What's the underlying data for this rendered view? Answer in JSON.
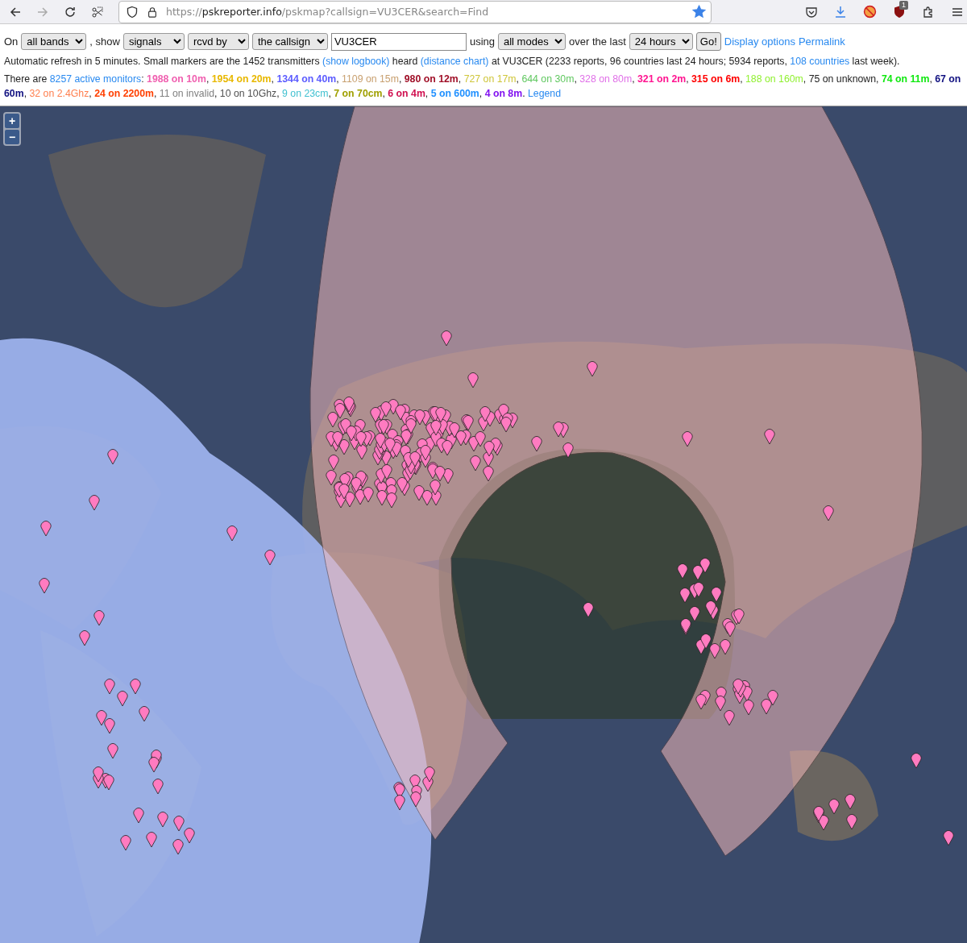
{
  "browser": {
    "back_enabled": true,
    "forward_enabled": false,
    "url": {
      "scheme": "https://",
      "host": "pskreporter.info",
      "path": "/pskmap?callsign=VU3CER&search=Find"
    },
    "bookmarked": true,
    "extension_badge": "1"
  },
  "controls": [
    {
      "kind": "text",
      "text": "On"
    },
    {
      "kind": "select",
      "value": "all bands"
    },
    {
      "kind": "text",
      "text": ", show"
    },
    {
      "kind": "select",
      "value": "signals"
    },
    {
      "kind": "select",
      "value": "rcvd by"
    },
    {
      "kind": "select",
      "value": "the callsign"
    },
    {
      "kind": "input",
      "value": "VU3CER"
    },
    {
      "kind": "text",
      "text": "using"
    },
    {
      "kind": "select",
      "value": "all modes"
    },
    {
      "kind": "text",
      "text": "over the last"
    },
    {
      "kind": "select",
      "value": "24 hours"
    },
    {
      "kind": "button",
      "text": "Go!"
    },
    {
      "kind": "link",
      "text": "Display options"
    },
    {
      "kind": "link",
      "text": "Permalink"
    }
  ],
  "refresh_line": [
    {
      "kind": "text",
      "text": "Automatic refresh in 5 minutes. Small markers are the 1452 transmitters "
    },
    {
      "kind": "link",
      "text": "(show logbook)"
    },
    {
      "kind": "text",
      "text": " heard "
    },
    {
      "kind": "link",
      "text": "(distance chart)"
    },
    {
      "kind": "text",
      "text": " at VU3CER (2233 reports, 96 countries last 24 hours; 5934 reports, "
    },
    {
      "kind": "link",
      "text": "108 countries"
    },
    {
      "kind": "text",
      "text": " last week)."
    }
  ],
  "monitors_line": [
    {
      "kind": "text",
      "text": "There are "
    },
    {
      "kind": "link",
      "text": "8257 active monitors"
    },
    {
      "kind": "text",
      "text": ": "
    },
    {
      "kind": "band",
      "text": "1988 on 10m",
      "color": "#f060b0",
      "bold": true
    },
    {
      "kind": "text",
      "text": ", "
    },
    {
      "kind": "band",
      "text": "1954 on 20m",
      "color": "#e8b800",
      "bold": true
    },
    {
      "kind": "text",
      "text": ", "
    },
    {
      "kind": "band",
      "text": "1344 on 40m",
      "color": "#5c5cff",
      "bold": true
    },
    {
      "kind": "text",
      "text": ", "
    },
    {
      "kind": "band",
      "text": "1109 on 15m",
      "color": "#c8a070",
      "bold": false
    },
    {
      "kind": "text",
      "text": ", "
    },
    {
      "kind": "band",
      "text": "980 on 12m",
      "color": "#a01028",
      "bold": true
    },
    {
      "kind": "text",
      "text": ", "
    },
    {
      "kind": "band",
      "text": "727 on 17m",
      "color": "#cfc63a",
      "bold": false
    },
    {
      "kind": "text",
      "text": ", "
    },
    {
      "kind": "band",
      "text": "644 on 30m",
      "color": "#60c860",
      "bold": false
    },
    {
      "kind": "text",
      "text": ", "
    },
    {
      "kind": "band",
      "text": "328 on 80m",
      "color": "#e070e8",
      "bold": false
    },
    {
      "kind": "text",
      "text": ", "
    },
    {
      "kind": "band",
      "text": "321 on 2m",
      "color": "#ff1490",
      "bold": true
    },
    {
      "kind": "text",
      "text": ", "
    },
    {
      "kind": "band",
      "text": "315 on 6m",
      "color": "#ff0000",
      "bold": true
    },
    {
      "kind": "text",
      "text": ", "
    },
    {
      "kind": "band",
      "text": "188 on 160m",
      "color": "#90f030",
      "bold": false
    },
    {
      "kind": "text",
      "text": ", 75 on unknown, "
    },
    {
      "kind": "band",
      "text": "74 on 11m",
      "color": "#10e810",
      "bold": true
    },
    {
      "kind": "text",
      "text": ", "
    },
    {
      "kind": "band",
      "text": "67 on 60m",
      "color": "#101080",
      "bold": true
    },
    {
      "kind": "text",
      "text": ", "
    },
    {
      "kind": "band",
      "text": "32 on 2.4Ghz",
      "color": "#ff8050",
      "bold": false
    },
    {
      "kind": "text",
      "text": ", "
    },
    {
      "kind": "band",
      "text": "24 on 2200m",
      "color": "#ff4000",
      "bold": true
    },
    {
      "kind": "text",
      "text": ", "
    },
    {
      "kind": "band",
      "text": "11 on invalid",
      "color": "#808080",
      "bold": false
    },
    {
      "kind": "text",
      "text": ", "
    },
    {
      "kind": "band",
      "text": "10 on 10Ghz",
      "color": "#505050",
      "bold": false
    },
    {
      "kind": "text",
      "text": ", "
    },
    {
      "kind": "band",
      "text": "9 on 23cm",
      "color": "#40c0d0",
      "bold": false
    },
    {
      "kind": "text",
      "text": ", "
    },
    {
      "kind": "band",
      "text": "7 on 70cm",
      "color": "#a0a000",
      "bold": true
    },
    {
      "kind": "text",
      "text": ", "
    },
    {
      "kind": "band",
      "text": "6 on 4m",
      "color": "#d01050",
      "bold": true
    },
    {
      "kind": "text",
      "text": ", "
    },
    {
      "kind": "band",
      "text": "5 on 600m",
      "color": "#2090ff",
      "bold": true
    },
    {
      "kind": "text",
      "text": ", "
    },
    {
      "kind": "band",
      "text": "4 on 8m",
      "color": "#8010f0",
      "bold": true
    },
    {
      "kind": "text",
      "text": ". "
    },
    {
      "kind": "link",
      "text": "Legend"
    }
  ],
  "map": {
    "zoom_in": "+",
    "zoom_out": "−"
  }
}
